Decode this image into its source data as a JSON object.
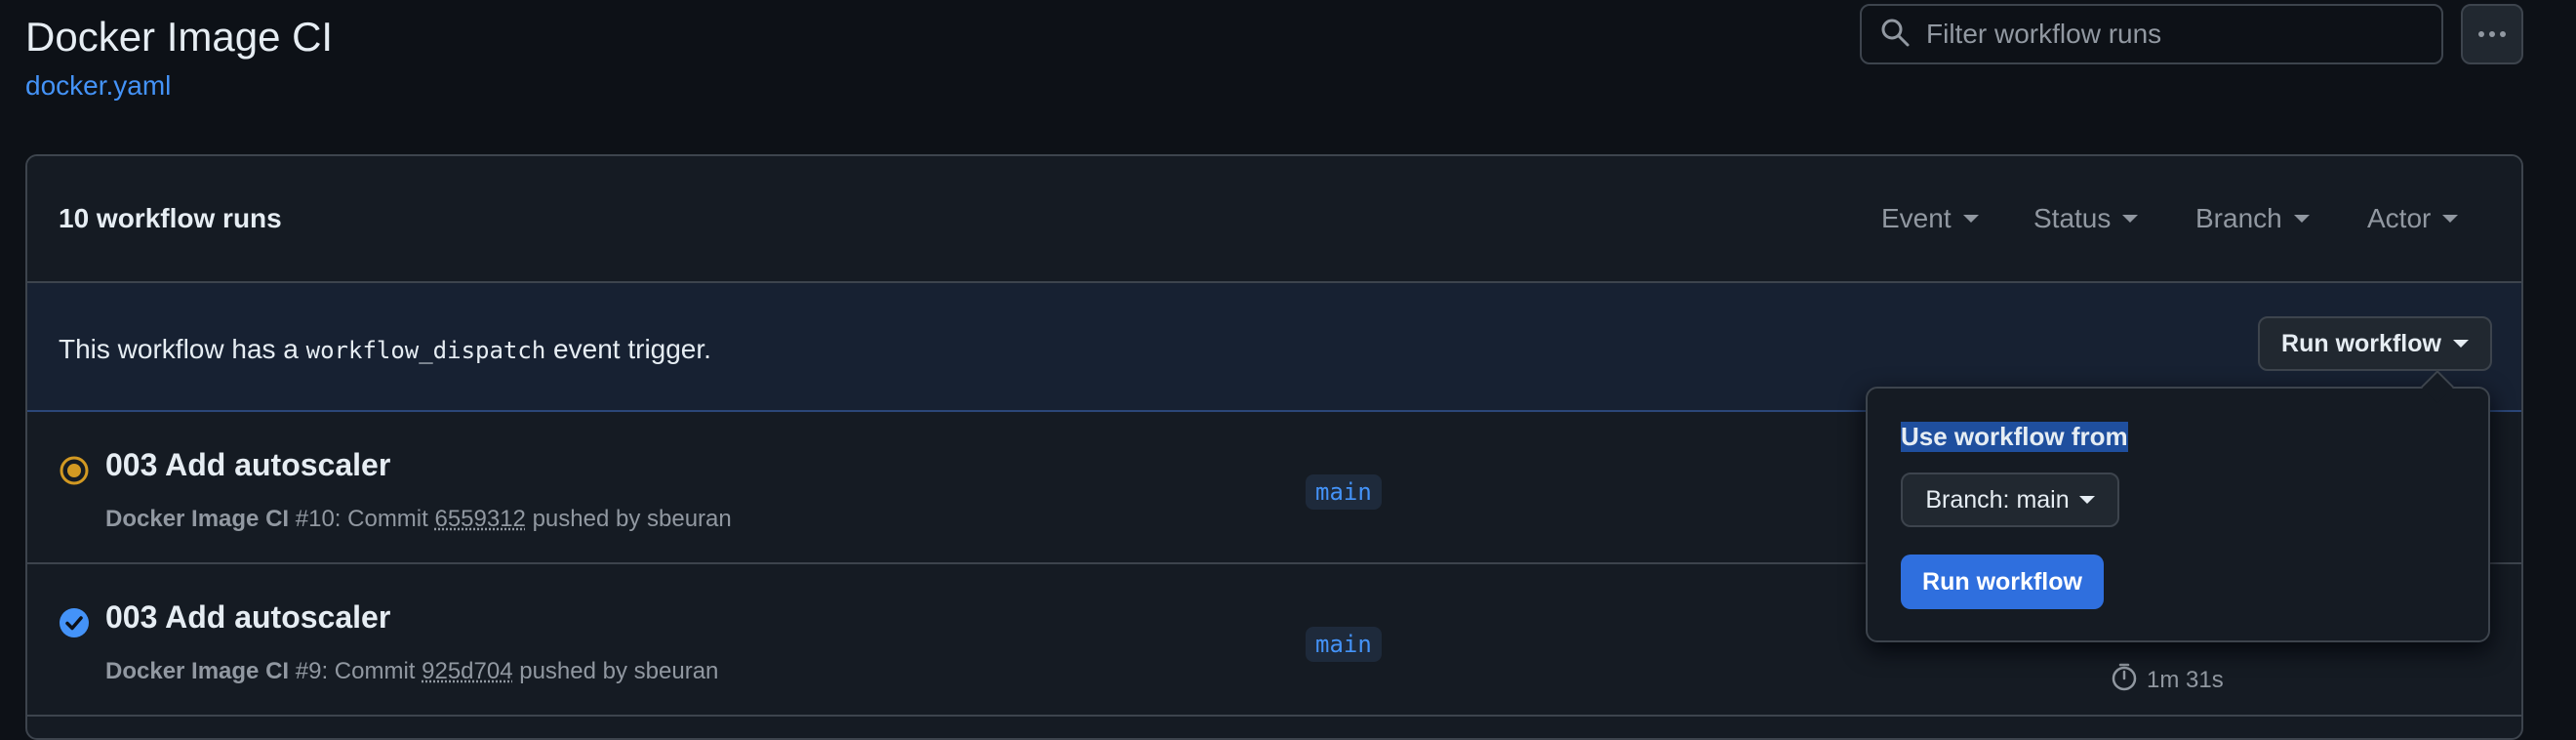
{
  "header": {
    "title": "Docker Image CI",
    "workflow_file": "docker.yaml",
    "search_placeholder": "Filter workflow runs"
  },
  "runs_panel": {
    "count_label": "10 workflow runs",
    "filters": [
      "Event",
      "Status",
      "Branch",
      "Actor"
    ]
  },
  "dispatch_banner": {
    "text_before": "This workflow has a ",
    "code": "workflow_dispatch",
    "text_after": " event trigger.",
    "run_button_label": "Run workflow"
  },
  "runs": [
    {
      "title": "003 Add autoscaler",
      "workflow": "Docker Image CI",
      "run_number": "#10",
      "commit_prefix": ": Commit ",
      "commit_sha": "6559312",
      "pushed_by": " pushed by sbeuran",
      "branch": "main",
      "status": "in_progress",
      "duration": ""
    },
    {
      "title": "003 Add autoscaler",
      "workflow": "Docker Image CI",
      "run_number": "#9",
      "commit_prefix": ": Commit ",
      "commit_sha": "925d704",
      "pushed_by": " pushed by sbeuran",
      "branch": "main",
      "status": "success",
      "duration": "1m 31s"
    }
  ],
  "popover": {
    "title": "Use workflow from",
    "branch_select_label": "Branch: main",
    "run_button_label": "Run workflow"
  },
  "colors": {
    "background": "#0d1117",
    "link": "#4493f8",
    "in_progress": "#d29922",
    "success": "#4493f8",
    "primary_button": "#2f6fde"
  }
}
